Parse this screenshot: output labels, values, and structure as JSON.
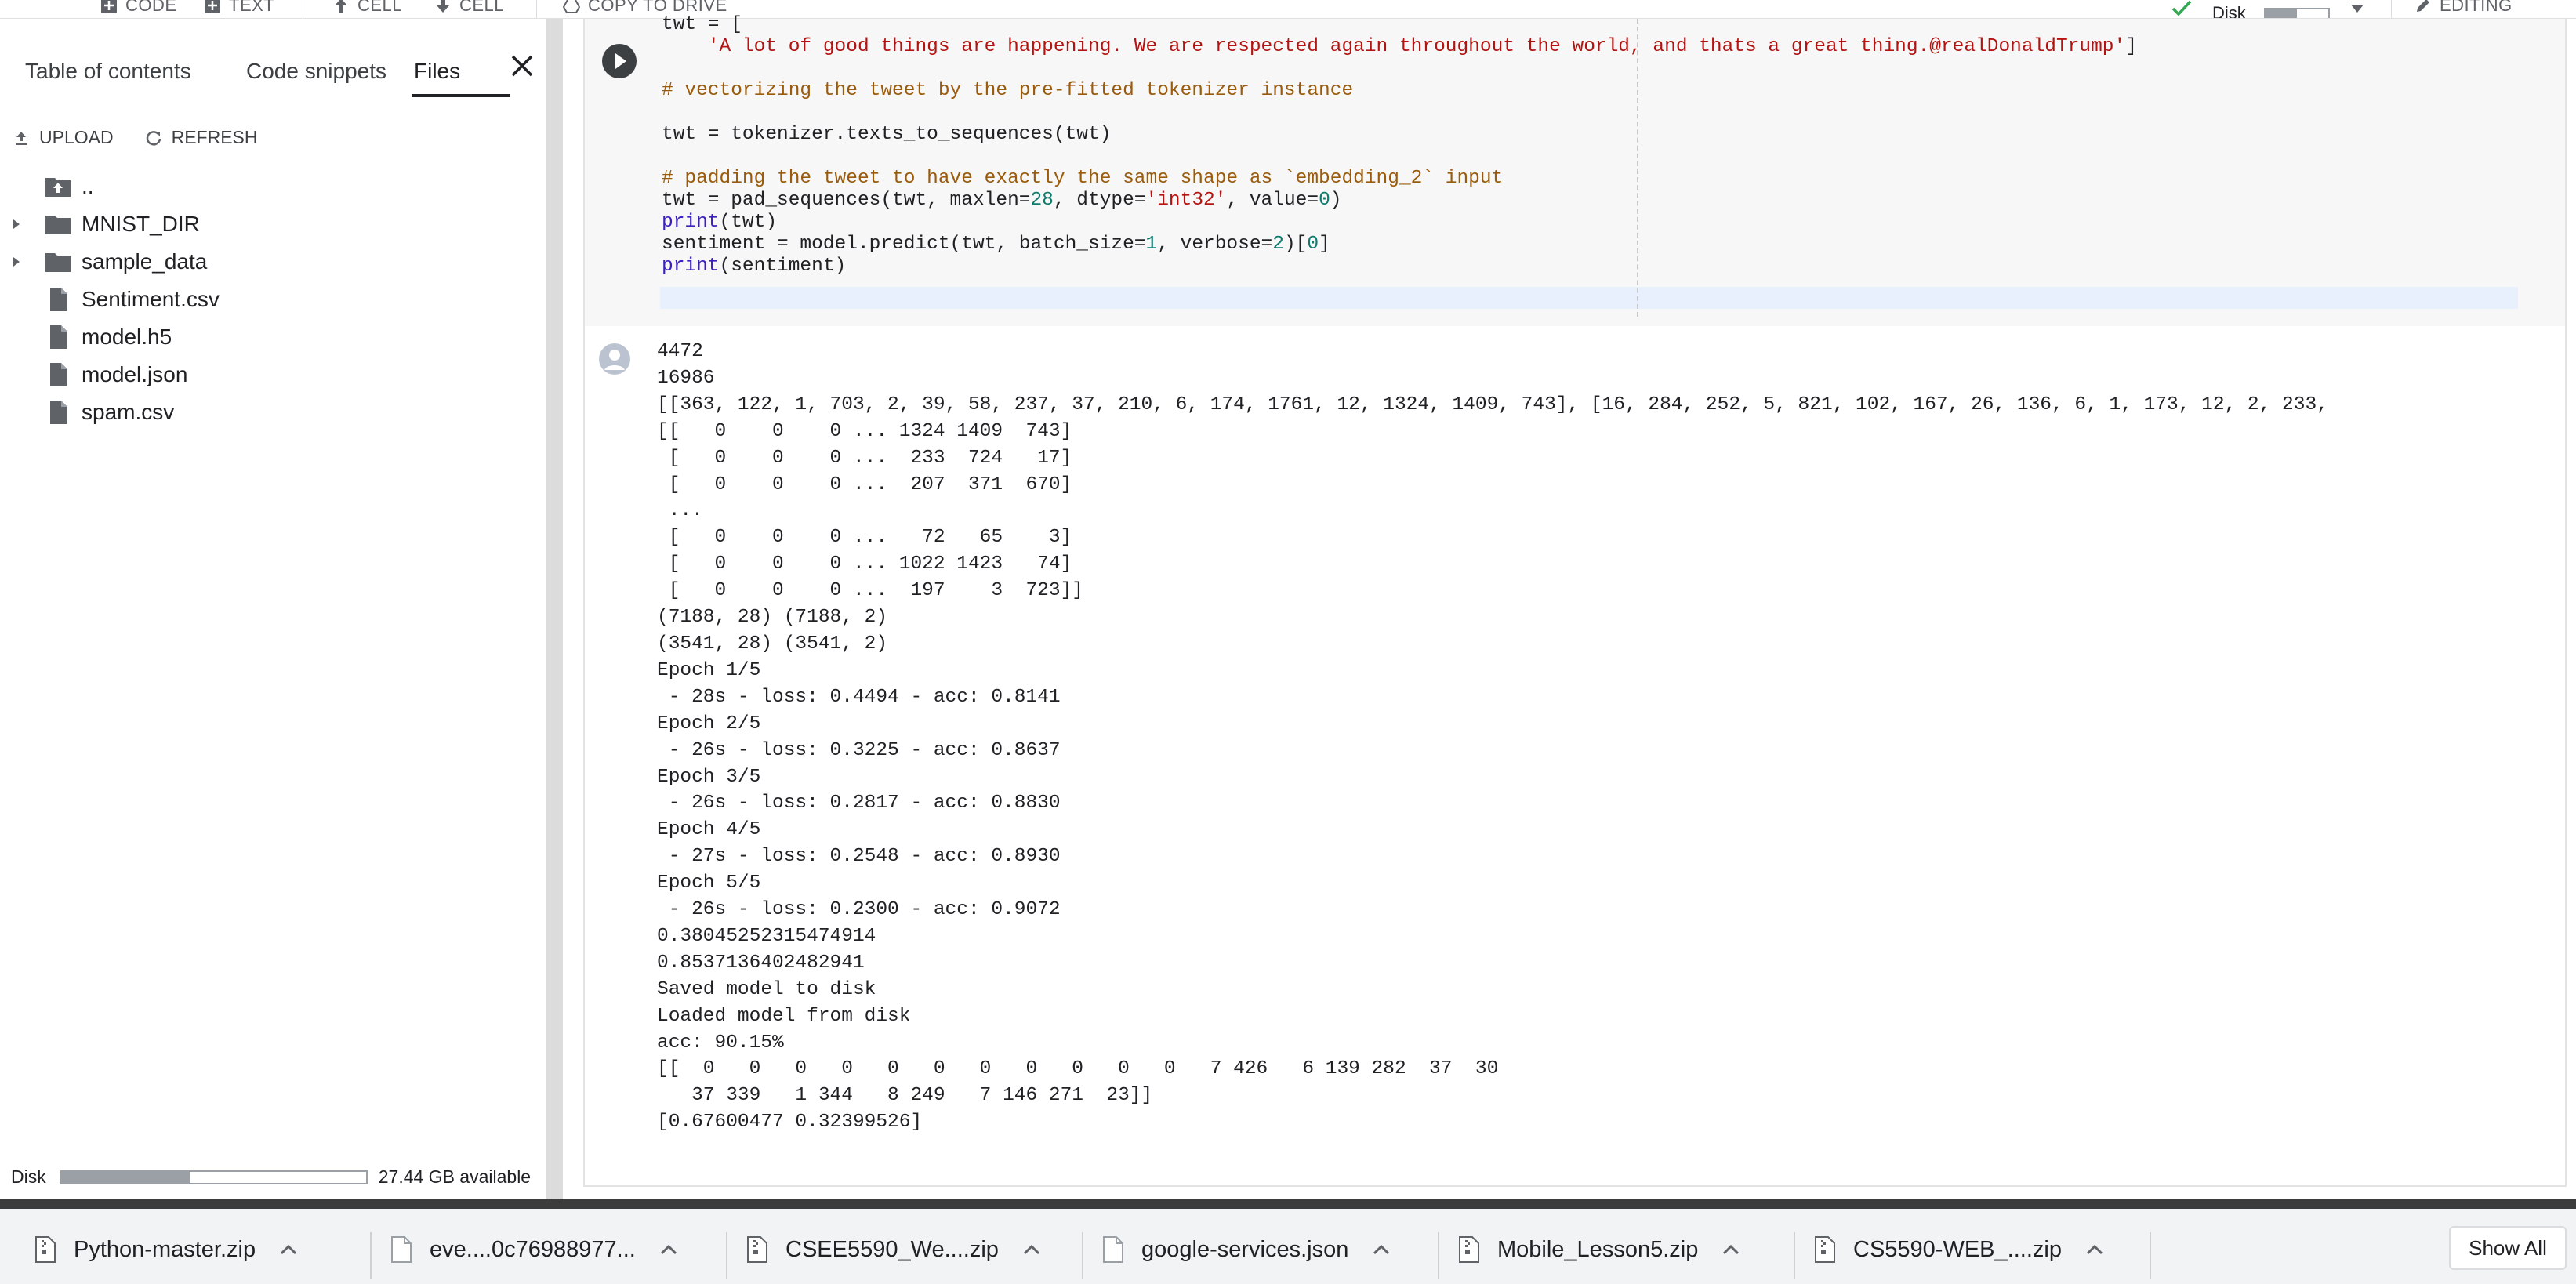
{
  "toolbar": {
    "add_code": "CODE",
    "add_text": "TEXT",
    "cell_up": "CELL",
    "cell_down": "CELL",
    "copy_to_drive": "COPY TO DRIVE",
    "disk_label": "Disk",
    "disk_fraction": 0.5,
    "editing": "EDITING"
  },
  "sidebar": {
    "tabs": [
      "Table of contents",
      "Code snippets",
      "Files"
    ],
    "active_tab": "Files",
    "upload": "UPLOAD",
    "refresh": "REFRESH",
    "files": [
      {
        "name": "..",
        "type": "parent",
        "expandable": false
      },
      {
        "name": "MNIST_DIR",
        "type": "folder",
        "expandable": true
      },
      {
        "name": "sample_data",
        "type": "folder",
        "expandable": true
      },
      {
        "name": "Sentiment.csv",
        "type": "file",
        "expandable": false
      },
      {
        "name": "model.h5",
        "type": "file",
        "expandable": false
      },
      {
        "name": "model.json",
        "type": "file",
        "expandable": false
      },
      {
        "name": "spam.csv",
        "type": "file",
        "expandable": false
      }
    ],
    "disk_label": "Disk",
    "disk_fraction": 0.42,
    "disk_available": "27.44 GB available"
  },
  "code_lines": [
    [
      {
        "t": "twt = ["
      }
    ],
    [
      {
        "t": "    "
      },
      {
        "t": "'A lot of good things are happening. We are respected again throughout the world, and thats a great thing.@realDonaldTrump'",
        "c": "s"
      },
      {
        "t": "]"
      }
    ],
    [
      {
        "t": ""
      }
    ],
    [
      {
        "t": "# vectorizing the tweet by the pre-fitted tokenizer instance",
        "c": "c"
      }
    ],
    [
      {
        "t": ""
      }
    ],
    [
      {
        "t": "twt = tokenizer.texts_to_sequences(twt)"
      }
    ],
    [
      {
        "t": ""
      }
    ],
    [
      {
        "t": "# padding the tweet to have exactly the same shape as `embedding_2` input",
        "c": "c"
      }
    ],
    [
      {
        "t": "twt = pad_sequences(twt, maxlen="
      },
      {
        "t": "28",
        "c": "n"
      },
      {
        "t": ", dtype="
      },
      {
        "t": "'int32'",
        "c": "s"
      },
      {
        "t": ", value="
      },
      {
        "t": "0",
        "c": "n"
      },
      {
        "t": ")"
      }
    ],
    [
      {
        "t": "print",
        "c": "k"
      },
      {
        "t": "(twt)"
      }
    ],
    [
      {
        "t": "sentiment = model.predict(twt, batch_size="
      },
      {
        "t": "1",
        "c": "n"
      },
      {
        "t": ", verbose="
      },
      {
        "t": "2",
        "c": "n"
      },
      {
        "t": ")["
      },
      {
        "t": "0",
        "c": "n"
      },
      {
        "t": "]"
      }
    ],
    [
      {
        "t": "print",
        "c": "k"
      },
      {
        "t": "(sentiment)"
      }
    ]
  ],
  "output_lines": [
    "4472",
    "16986",
    "[[363, 122, 1, 703, 2, 39, 58, 237, 37, 210, 6, 174, 1761, 12, 1324, 1409, 743], [16, 284, 252, 5, 821, 102, 167, 26, 136, 6, 1, 173, 12, 2, 233,",
    "[[   0    0    0 ... 1324 1409  743]",
    " [   0    0    0 ...  233  724   17]",
    " [   0    0    0 ...  207  371  670]",
    " ...",
    " [   0    0    0 ...   72   65    3]",
    " [   0    0    0 ... 1022 1423   74]",
    " [   0    0    0 ...  197    3  723]]",
    "(7188, 28) (7188, 2)",
    "(3541, 28) (3541, 2)",
    "Epoch 1/5",
    " - 28s - loss: 0.4494 - acc: 0.8141",
    "Epoch 2/5",
    " - 26s - loss: 0.3225 - acc: 0.8637",
    "Epoch 3/5",
    " - 26s - loss: 0.2817 - acc: 0.8830",
    "Epoch 4/5",
    " - 27s - loss: 0.2548 - acc: 0.8930",
    "Epoch 5/5",
    " - 26s - loss: 0.2300 - acc: 0.9072",
    "0.38045252315474914",
    "0.8537136402482941",
    "Saved model to disk",
    "Loaded model from disk",
    "acc: 90.15%",
    "[[  0   0   0   0   0   0   0   0   0   0   0   7 426   6 139 282  37  30",
    "   37 339   1 344   8 249   7 146 271  23]]",
    "[0.67600477 0.32399526]"
  ],
  "downloads": [
    {
      "name": "Python-master.zip",
      "type": "zip"
    },
    {
      "name": "eve....0c76988977...",
      "type": "file"
    },
    {
      "name": "CSEE5590_We....zip",
      "type": "zip"
    },
    {
      "name": "google-services.json",
      "type": "file"
    },
    {
      "name": "Mobile_Lesson5.zip",
      "type": "zip"
    },
    {
      "name": "CS5590-WEB_....zip",
      "type": "zip"
    }
  ],
  "show_all": "Show All"
}
